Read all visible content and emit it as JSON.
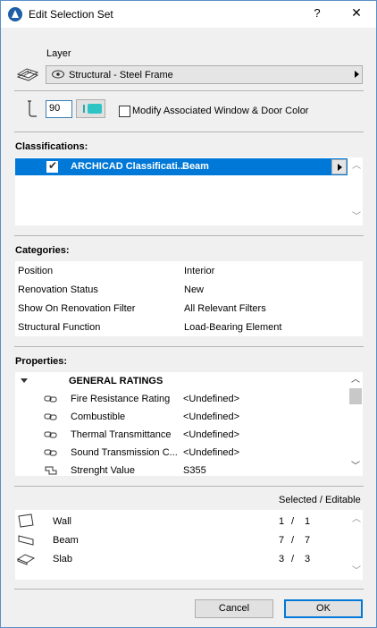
{
  "window": {
    "title": "Edit Selection Set"
  },
  "titlebar": {
    "help": "?",
    "close": "✕"
  },
  "layer": {
    "label": "Layer",
    "value": "Structural - Steel Frame"
  },
  "pen": {
    "value": "90",
    "modify_label": "Modify Associated Window & Door Color",
    "modify_checked": false
  },
  "classifications": {
    "heading": "Classifications:",
    "rows": [
      {
        "name": "ARCHICAD Classificati...",
        "value": "Beam",
        "checked": true
      }
    ]
  },
  "categories": {
    "heading": "Categories:",
    "rows": [
      {
        "name": "Position",
        "value": "Interior"
      },
      {
        "name": "Renovation Status",
        "value": "New"
      },
      {
        "name": "Show On Renovation Filter",
        "value": "All Relevant Filters"
      },
      {
        "name": "Structural Function",
        "value": "Load-Bearing Element"
      }
    ]
  },
  "properties": {
    "heading": "Properties:",
    "group": "GENERAL RATINGS",
    "rows": [
      {
        "name": "Fire Resistance Rating",
        "value": "<Undefined>",
        "icon": "link-icon"
      },
      {
        "name": "Combustible",
        "value": "<Undefined>",
        "icon": "link-icon"
      },
      {
        "name": "Thermal Transmittance",
        "value": "<Undefined>",
        "icon": "link-icon"
      },
      {
        "name": "Sound Transmission C...",
        "value": "<Undefined>",
        "icon": "link-icon"
      },
      {
        "name": "Strenght Value",
        "value": "S355",
        "icon": "custom-property-icon"
      }
    ]
  },
  "selection": {
    "header": "Selected / Editable",
    "rows": [
      {
        "name": "Wall",
        "selected": "1",
        "editable": "1",
        "icon": "wall-tool-icon"
      },
      {
        "name": "Beam",
        "selected": "7",
        "editable": "7",
        "icon": "beam-tool-icon"
      },
      {
        "name": "Slab",
        "selected": "3",
        "editable": "3",
        "icon": "slab-tool-icon"
      }
    ],
    "slash": "/"
  },
  "buttons": {
    "cancel": "Cancel",
    "ok": "OK"
  },
  "colors": {
    "selection": "#0078d7",
    "pen_swatch": "#2ec4c4"
  }
}
